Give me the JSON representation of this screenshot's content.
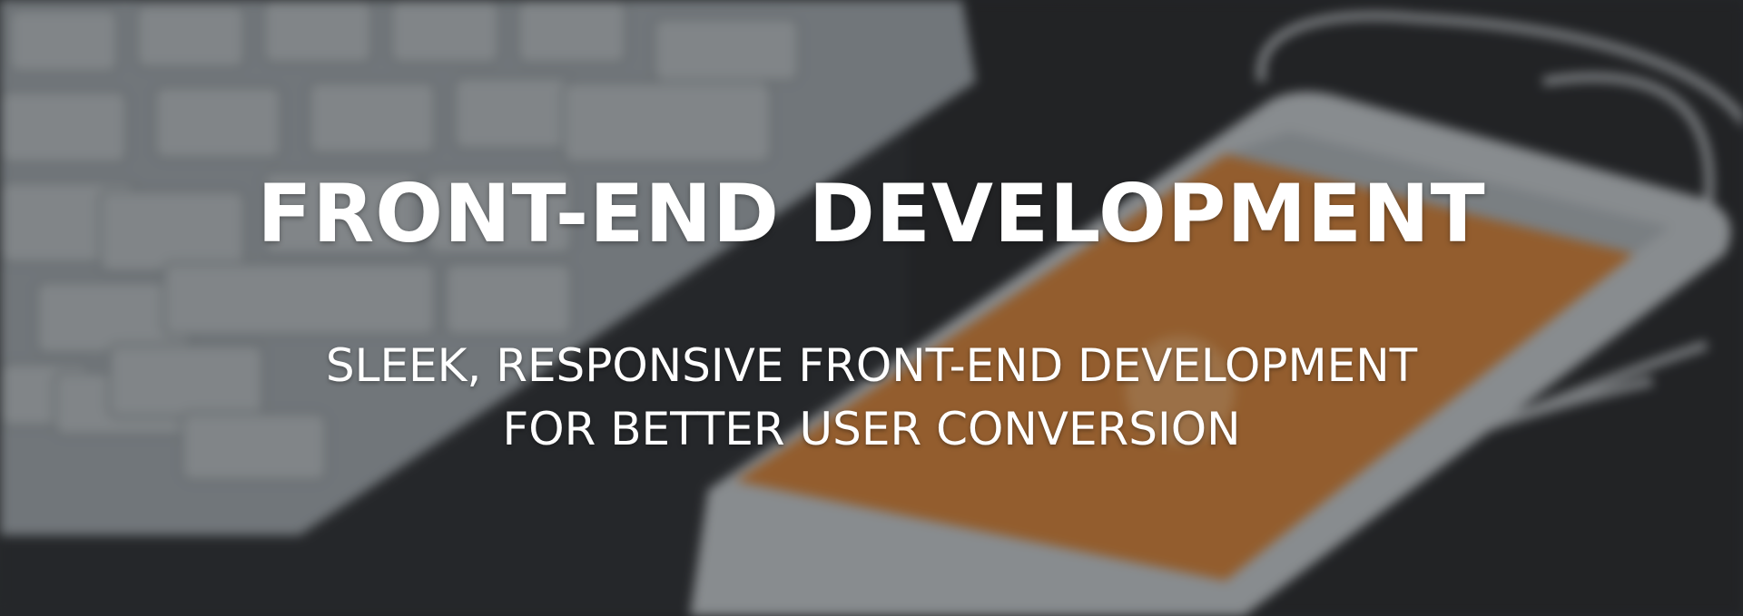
{
  "hero": {
    "title": "FRONT-END DEVELOPMENT",
    "subtitle_line1": "SLEEK, RESPONSIVE FRONT-END DEVELOPMENT",
    "subtitle_line2": "FOR BETTER USER CONVERSION"
  },
  "colors": {
    "text": "#ffffff",
    "phone_screen": "#e08a3c",
    "device_gray": "#c9cfd3",
    "desk": "#2e3133"
  },
  "background": {
    "description_icons": [
      "keyboard-image",
      "smartphone-image",
      "cable-image"
    ]
  }
}
